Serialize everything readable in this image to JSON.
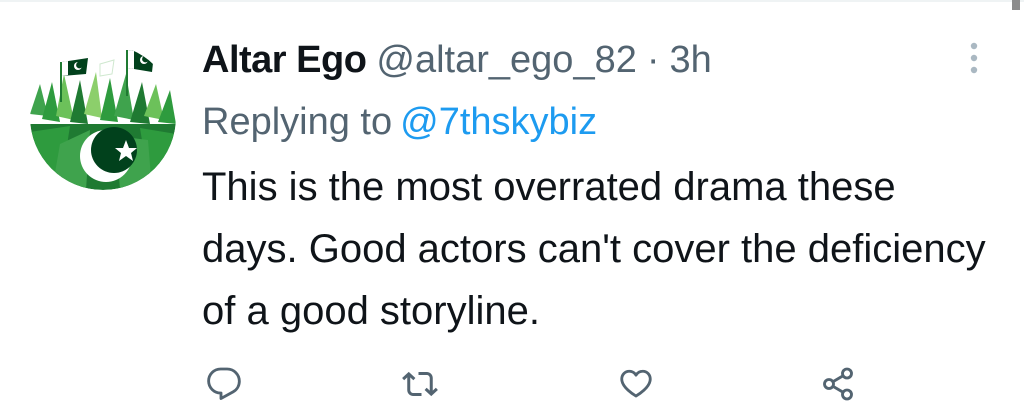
{
  "tweet": {
    "display_name": "Altar Ego",
    "handle": "@altar_ego_82",
    "separator": "·",
    "time": "3h",
    "replying_prefix": "Replying to",
    "replying_to": "@7thskybiz",
    "text": "This is the most overrated drama these days. Good actors can't cover the deficiency of a good storyline."
  },
  "avatar": {
    "description_icon": "pakistan-flags-crowd-avatar",
    "colors": {
      "dark_green": "#01411c",
      "green": "#2e9b3e",
      "light_green": "#8ccf6b",
      "white": "#ffffff"
    }
  },
  "actions": [
    {
      "name": "reply-button",
      "icon": "reply-icon"
    },
    {
      "name": "retweet-button",
      "icon": "retweet-icon"
    },
    {
      "name": "like-button",
      "icon": "heart-icon"
    },
    {
      "name": "share-button",
      "icon": "share-icon"
    }
  ],
  "colors": {
    "text_primary": "#0f1419",
    "text_secondary": "#536471",
    "link": "#1d9bf0",
    "icon": "#536471"
  }
}
